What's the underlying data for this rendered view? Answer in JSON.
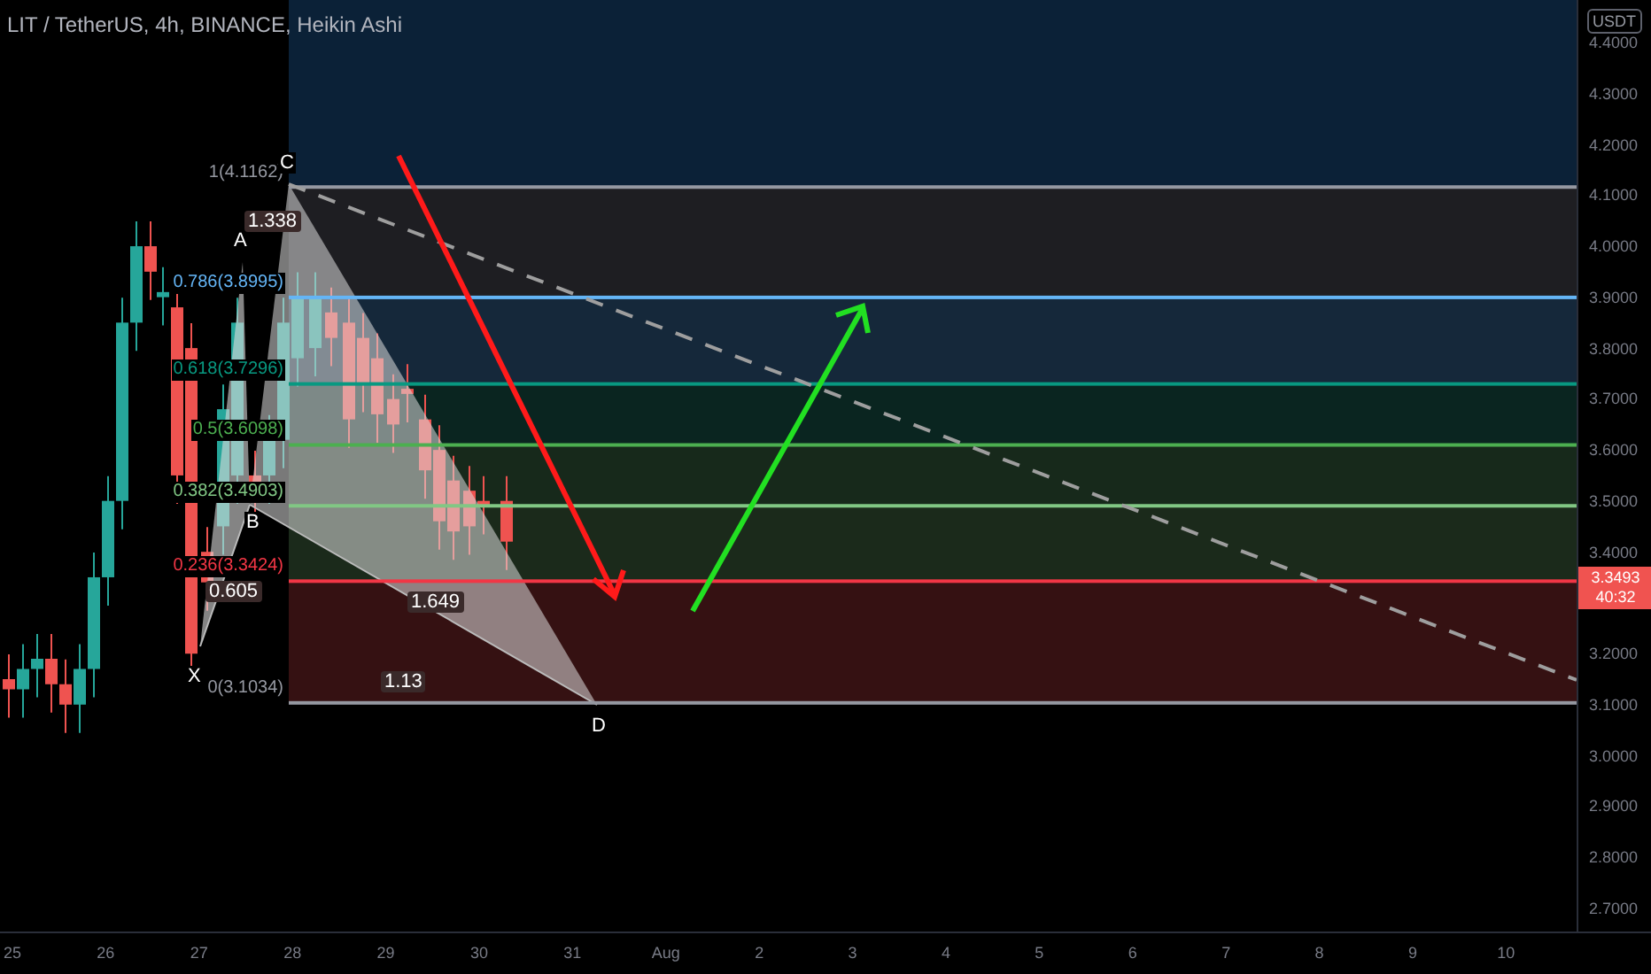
{
  "header": {
    "title": "LIT / TetherUS, 4h, BINANCE, Heikin Ashi"
  },
  "fib_levels": [
    {
      "label": "1(4.1162)",
      "color": "#9598a1"
    },
    {
      "label": "0.786(3.8995)",
      "color": "#64b5f6"
    },
    {
      "label": "0.618(3.7296)",
      "color": "#089981"
    },
    {
      "label": "0.5(3.6098)",
      "color": "#4caf50"
    },
    {
      "label": "0.382(3.4903)",
      "color": "#81c784"
    },
    {
      "label": "0.236(3.3424)",
      "color": "#f23645"
    },
    {
      "label": "0(3.1034)",
      "color": "#9598a1"
    }
  ],
  "pattern": {
    "points": [
      "X",
      "A",
      "B",
      "C",
      "D"
    ],
    "ratios": [
      "1.338",
      "0.605",
      "1.649",
      "1.13"
    ]
  },
  "price_axis": {
    "currency": "USDT",
    "ticks": [
      "4.4000",
      "4.3000",
      "4.2000",
      "4.1000",
      "4.0000",
      "3.9000",
      "3.8000",
      "3.7000",
      "3.6000",
      "3.5000",
      "3.4000",
      "3.2000",
      "3.1000",
      "3.0000",
      "2.9000",
      "2.8000",
      "2.7000"
    ],
    "last_price": {
      "value": "3.3493",
      "countdown": "40:32"
    }
  },
  "time_axis": {
    "ticks": [
      "25",
      "26",
      "27",
      "28",
      "29",
      "30",
      "31",
      "Aug",
      "2",
      "3",
      "4",
      "5",
      "6",
      "7",
      "8",
      "9",
      "10"
    ]
  }
}
